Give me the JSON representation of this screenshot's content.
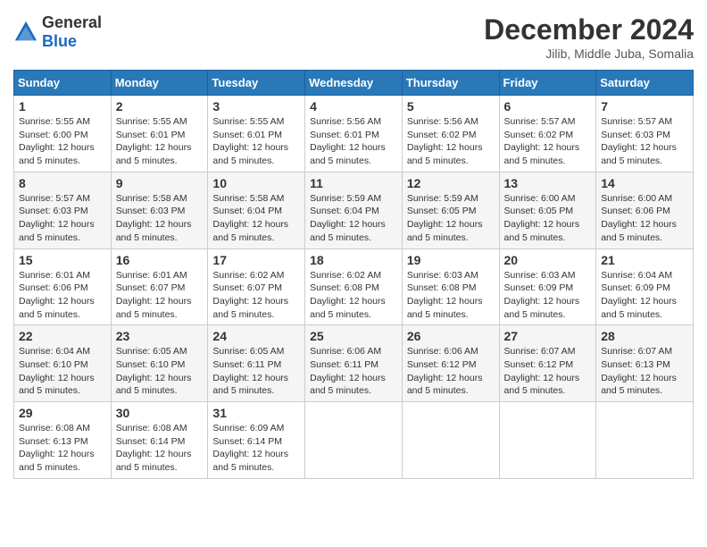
{
  "logo": {
    "general": "General",
    "blue": "Blue"
  },
  "title": "December 2024",
  "location": "Jilib, Middle Juba, Somalia",
  "weekdays": [
    "Sunday",
    "Monday",
    "Tuesday",
    "Wednesday",
    "Thursday",
    "Friday",
    "Saturday"
  ],
  "weeks": [
    [
      {
        "day": "1",
        "sunrise": "5:55 AM",
        "sunset": "6:00 PM",
        "daylight": "12 hours and 5 minutes."
      },
      {
        "day": "2",
        "sunrise": "5:55 AM",
        "sunset": "6:01 PM",
        "daylight": "12 hours and 5 minutes."
      },
      {
        "day": "3",
        "sunrise": "5:55 AM",
        "sunset": "6:01 PM",
        "daylight": "12 hours and 5 minutes."
      },
      {
        "day": "4",
        "sunrise": "5:56 AM",
        "sunset": "6:01 PM",
        "daylight": "12 hours and 5 minutes."
      },
      {
        "day": "5",
        "sunrise": "5:56 AM",
        "sunset": "6:02 PM",
        "daylight": "12 hours and 5 minutes."
      },
      {
        "day": "6",
        "sunrise": "5:57 AM",
        "sunset": "6:02 PM",
        "daylight": "12 hours and 5 minutes."
      },
      {
        "day": "7",
        "sunrise": "5:57 AM",
        "sunset": "6:03 PM",
        "daylight": "12 hours and 5 minutes."
      }
    ],
    [
      {
        "day": "8",
        "sunrise": "5:57 AM",
        "sunset": "6:03 PM",
        "daylight": "12 hours and 5 minutes."
      },
      {
        "day": "9",
        "sunrise": "5:58 AM",
        "sunset": "6:03 PM",
        "daylight": "12 hours and 5 minutes."
      },
      {
        "day": "10",
        "sunrise": "5:58 AM",
        "sunset": "6:04 PM",
        "daylight": "12 hours and 5 minutes."
      },
      {
        "day": "11",
        "sunrise": "5:59 AM",
        "sunset": "6:04 PM",
        "daylight": "12 hours and 5 minutes."
      },
      {
        "day": "12",
        "sunrise": "5:59 AM",
        "sunset": "6:05 PM",
        "daylight": "12 hours and 5 minutes."
      },
      {
        "day": "13",
        "sunrise": "6:00 AM",
        "sunset": "6:05 PM",
        "daylight": "12 hours and 5 minutes."
      },
      {
        "day": "14",
        "sunrise": "6:00 AM",
        "sunset": "6:06 PM",
        "daylight": "12 hours and 5 minutes."
      }
    ],
    [
      {
        "day": "15",
        "sunrise": "6:01 AM",
        "sunset": "6:06 PM",
        "daylight": "12 hours and 5 minutes."
      },
      {
        "day": "16",
        "sunrise": "6:01 AM",
        "sunset": "6:07 PM",
        "daylight": "12 hours and 5 minutes."
      },
      {
        "day": "17",
        "sunrise": "6:02 AM",
        "sunset": "6:07 PM",
        "daylight": "12 hours and 5 minutes."
      },
      {
        "day": "18",
        "sunrise": "6:02 AM",
        "sunset": "6:08 PM",
        "daylight": "12 hours and 5 minutes."
      },
      {
        "day": "19",
        "sunrise": "6:03 AM",
        "sunset": "6:08 PM",
        "daylight": "12 hours and 5 minutes."
      },
      {
        "day": "20",
        "sunrise": "6:03 AM",
        "sunset": "6:09 PM",
        "daylight": "12 hours and 5 minutes."
      },
      {
        "day": "21",
        "sunrise": "6:04 AM",
        "sunset": "6:09 PM",
        "daylight": "12 hours and 5 minutes."
      }
    ],
    [
      {
        "day": "22",
        "sunrise": "6:04 AM",
        "sunset": "6:10 PM",
        "daylight": "12 hours and 5 minutes."
      },
      {
        "day": "23",
        "sunrise": "6:05 AM",
        "sunset": "6:10 PM",
        "daylight": "12 hours and 5 minutes."
      },
      {
        "day": "24",
        "sunrise": "6:05 AM",
        "sunset": "6:11 PM",
        "daylight": "12 hours and 5 minutes."
      },
      {
        "day": "25",
        "sunrise": "6:06 AM",
        "sunset": "6:11 PM",
        "daylight": "12 hours and 5 minutes."
      },
      {
        "day": "26",
        "sunrise": "6:06 AM",
        "sunset": "6:12 PM",
        "daylight": "12 hours and 5 minutes."
      },
      {
        "day": "27",
        "sunrise": "6:07 AM",
        "sunset": "6:12 PM",
        "daylight": "12 hours and 5 minutes."
      },
      {
        "day": "28",
        "sunrise": "6:07 AM",
        "sunset": "6:13 PM",
        "daylight": "12 hours and 5 minutes."
      }
    ],
    [
      {
        "day": "29",
        "sunrise": "6:08 AM",
        "sunset": "6:13 PM",
        "daylight": "12 hours and 5 minutes."
      },
      {
        "day": "30",
        "sunrise": "6:08 AM",
        "sunset": "6:14 PM",
        "daylight": "12 hours and 5 minutes."
      },
      {
        "day": "31",
        "sunrise": "6:09 AM",
        "sunset": "6:14 PM",
        "daylight": "12 hours and 5 minutes."
      },
      null,
      null,
      null,
      null
    ]
  ]
}
